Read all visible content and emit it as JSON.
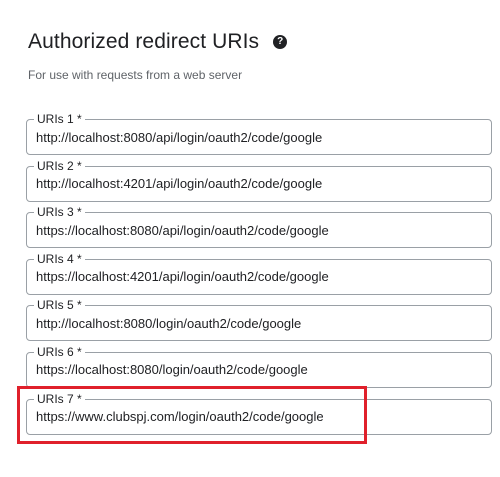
{
  "section": {
    "title": "Authorized redirect URIs",
    "help_icon": "help-circle-icon",
    "help_glyph": "?",
    "description": "For use with requests from a web server"
  },
  "uris": [
    {
      "label": "URIs 1 *",
      "value": "http://localhost:8080/api/login/oauth2/code/google"
    },
    {
      "label": "URIs 2 *",
      "value": "http://localhost:4201/api/login/oauth2/code/google"
    },
    {
      "label": "URIs 3 *",
      "value": "https://localhost:8080/api/login/oauth2/code/google"
    },
    {
      "label": "URIs 4 *",
      "value": "https://localhost:4201/api/login/oauth2/code/google"
    },
    {
      "label": "URIs 5 *",
      "value": "http://localhost:8080/login/oauth2/code/google"
    },
    {
      "label": "URIs 6 *",
      "value": "https://localhost:8080/login/oauth2/code/google"
    },
    {
      "label": "URIs 7 *",
      "value": "https://www.clubspj.com/login/oauth2/code/google"
    }
  ],
  "annotation": {
    "highlight_color": "#e0202b",
    "highlighted_item": "URIs 7 *"
  }
}
